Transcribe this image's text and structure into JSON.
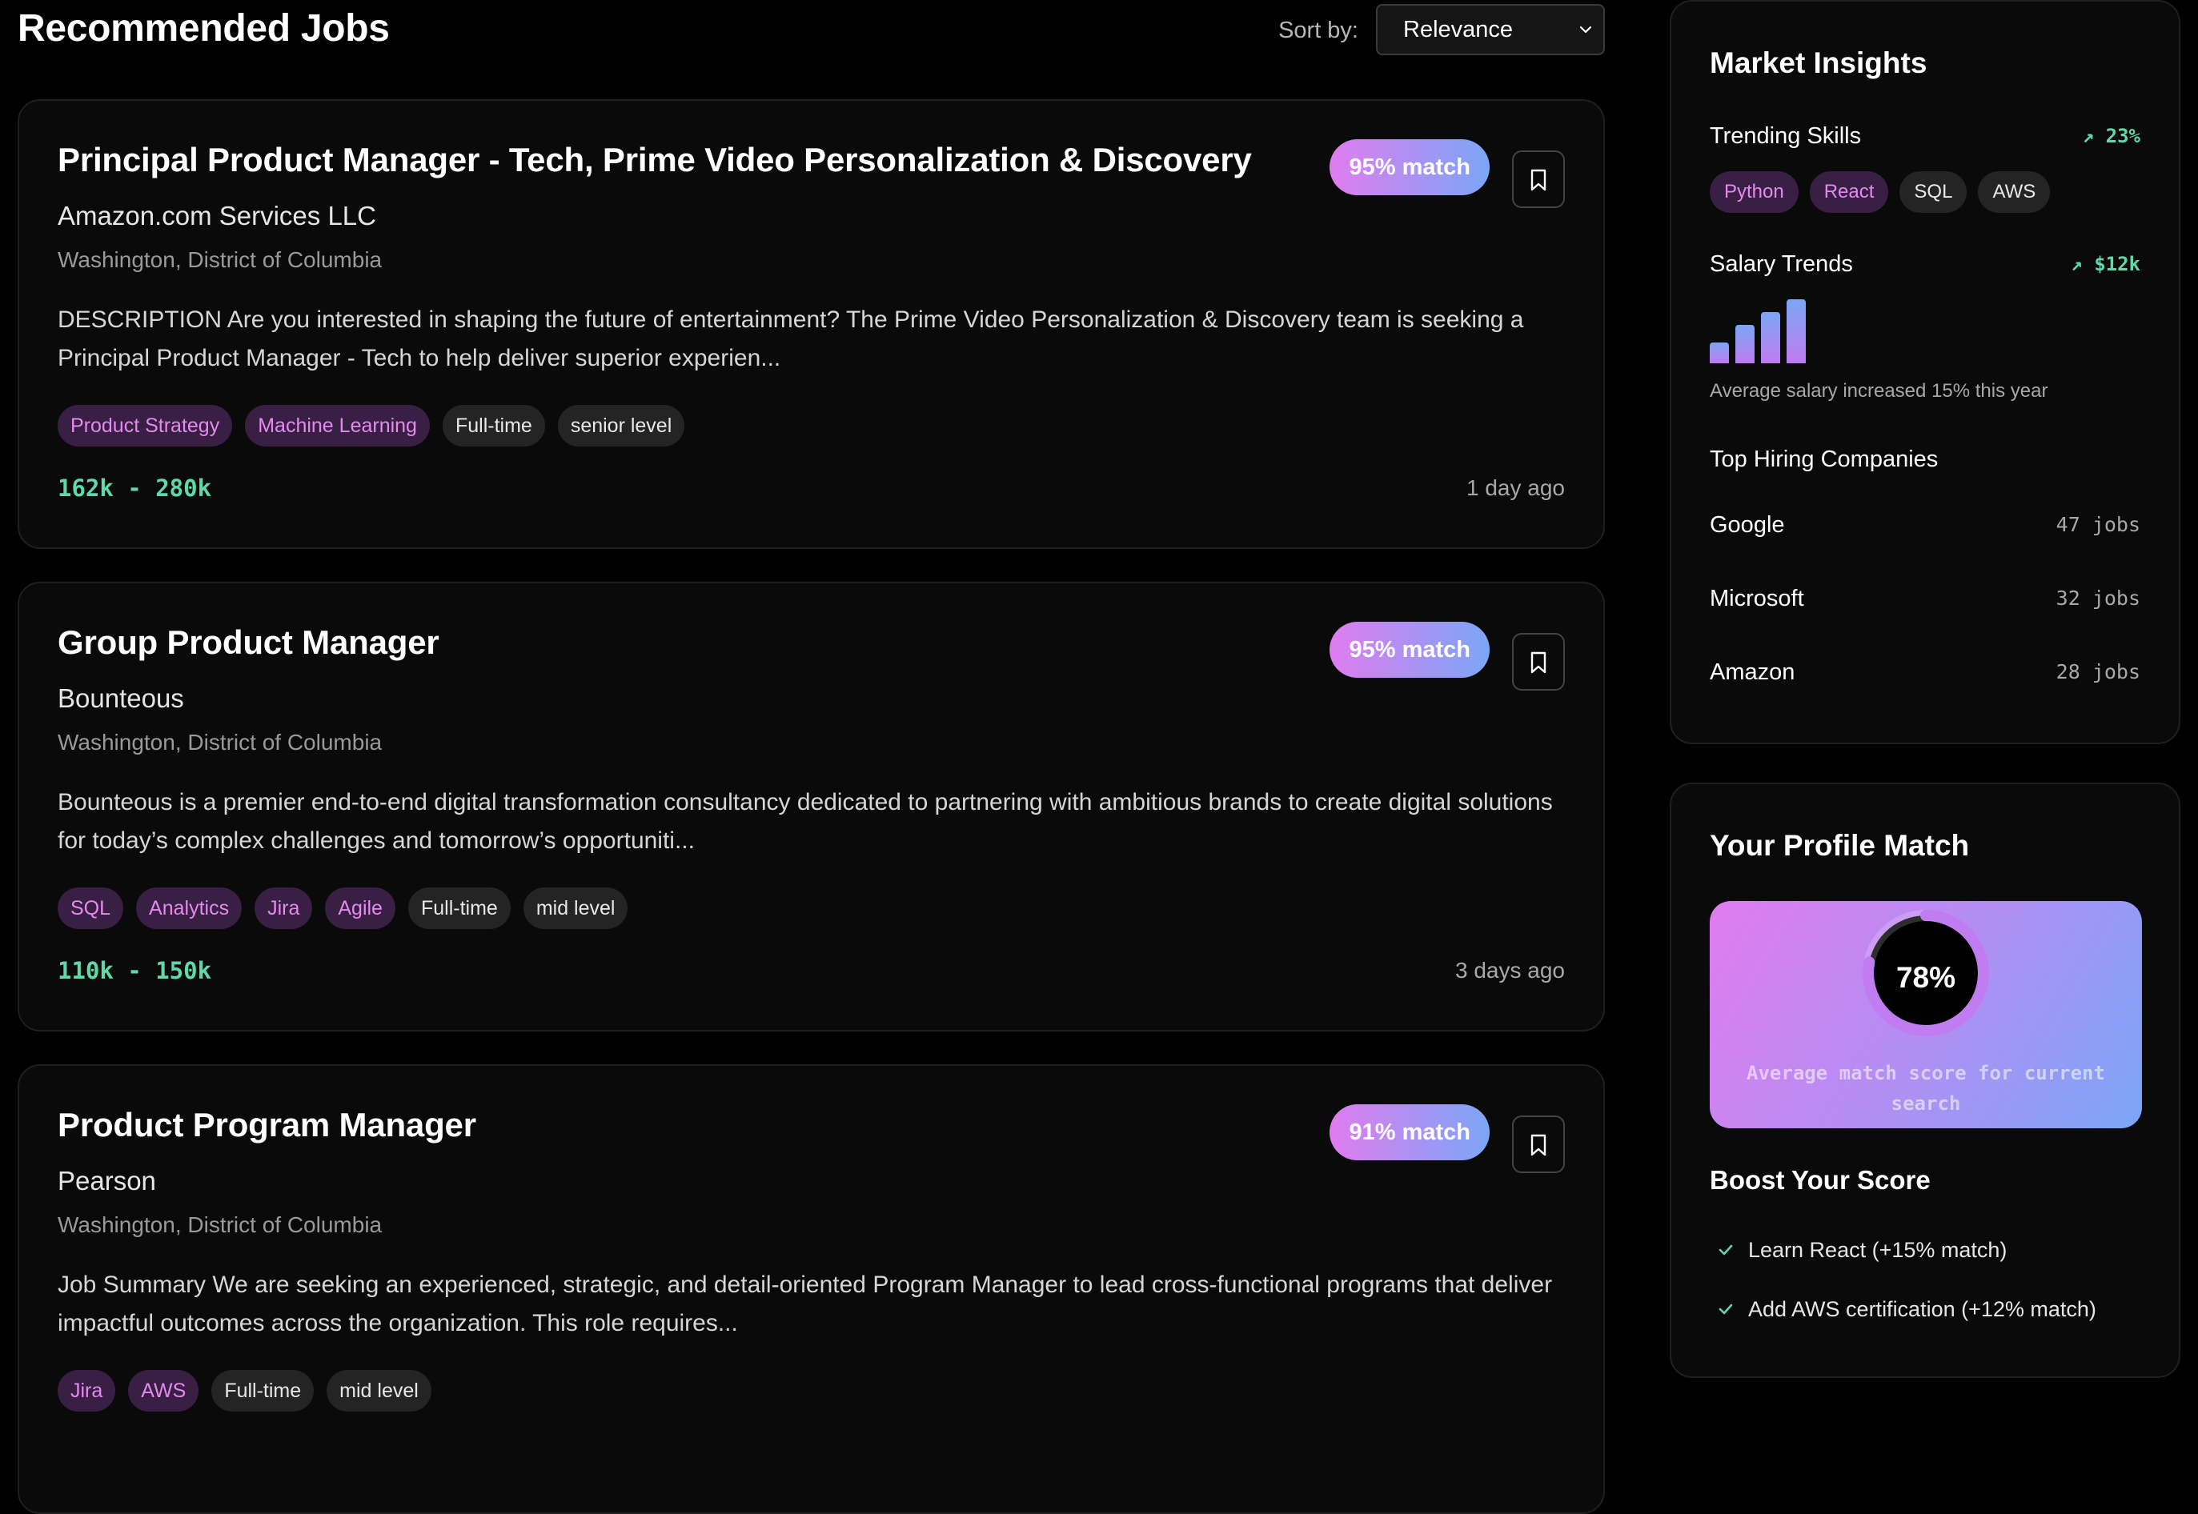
{
  "header": {
    "title": "Recommended Jobs",
    "sort_label": "Sort by:",
    "sort_value": "Relevance"
  },
  "jobs": [
    {
      "title": "Principal Product Manager - Tech, Prime Video Personalization & Discovery",
      "company": "Amazon.com Services LLC",
      "location": "Washington, District of Columbia",
      "description": "DESCRIPTION Are you interested in shaping the future of entertainment? The Prime Video Personalization & Discovery team is seeking a Principal Product Manager - Tech to help deliver superior experien...",
      "match": "95% match",
      "skills": [
        "Product Strategy",
        "Machine Learning"
      ],
      "meta": [
        "Full-time",
        "senior level"
      ],
      "salary": "162k - 280k",
      "posted": "1 day ago"
    },
    {
      "title": "Group Product Manager",
      "company": "Bounteous",
      "location": "Washington, District of Columbia",
      "description": "Bounteous is a premier end-to-end digital transformation consultancy dedicated to partnering with ambitious brands to create digital solutions for today’s complex challenges and tomorrow’s opportuniti...",
      "match": "95% match",
      "skills": [
        "SQL",
        "Analytics",
        "Jira",
        "Agile"
      ],
      "meta": [
        "Full-time",
        "mid level"
      ],
      "salary": "110k - 150k",
      "posted": "3 days ago"
    },
    {
      "title": "Product Program Manager",
      "company": "Pearson",
      "location": "Washington, District of Columbia",
      "description": "Job Summary We are seeking an experienced, strategic, and detail-oriented Program Manager to lead cross-functional programs that deliver impactful outcomes across the organization. This role requires...",
      "match": "91% match",
      "skills": [
        "Jira",
        "AWS"
      ],
      "meta": [
        "Full-time",
        "mid level"
      ],
      "salary": "",
      "posted": ""
    }
  ],
  "insights": {
    "title": "Market Insights",
    "trending_label": "Trending Skills",
    "trending_change": "↗ 23%",
    "trending_skills_hot": [
      "Python",
      "React"
    ],
    "trending_skills": [
      "SQL",
      "AWS"
    ],
    "salary_label": "Salary Trends",
    "salary_change": "↗ $12k",
    "salary_bars": [
      0.33,
      0.6,
      0.8,
      1.0
    ],
    "salary_note": "Average salary increased 15% this year",
    "companies_label": "Top Hiring Companies",
    "companies": [
      {
        "name": "Google",
        "count": "47 jobs"
      },
      {
        "name": "Microsoft",
        "count": "32 jobs"
      },
      {
        "name": "Amazon",
        "count": "28 jobs"
      }
    ]
  },
  "profile": {
    "title": "Your Profile Match",
    "score": "78%",
    "score_fraction": 0.78,
    "caption": "Average match score for current search",
    "boost_title": "Boost Your Score",
    "boost_items": [
      "Learn React (+15% match)",
      "Add AWS certification (+12% match)"
    ]
  },
  "colors": {
    "accent_pink": "#e07cf0",
    "accent_blue": "#7ba6f6",
    "salary_green": "#5fd8ab",
    "skill_bg": "#3a1f44"
  }
}
